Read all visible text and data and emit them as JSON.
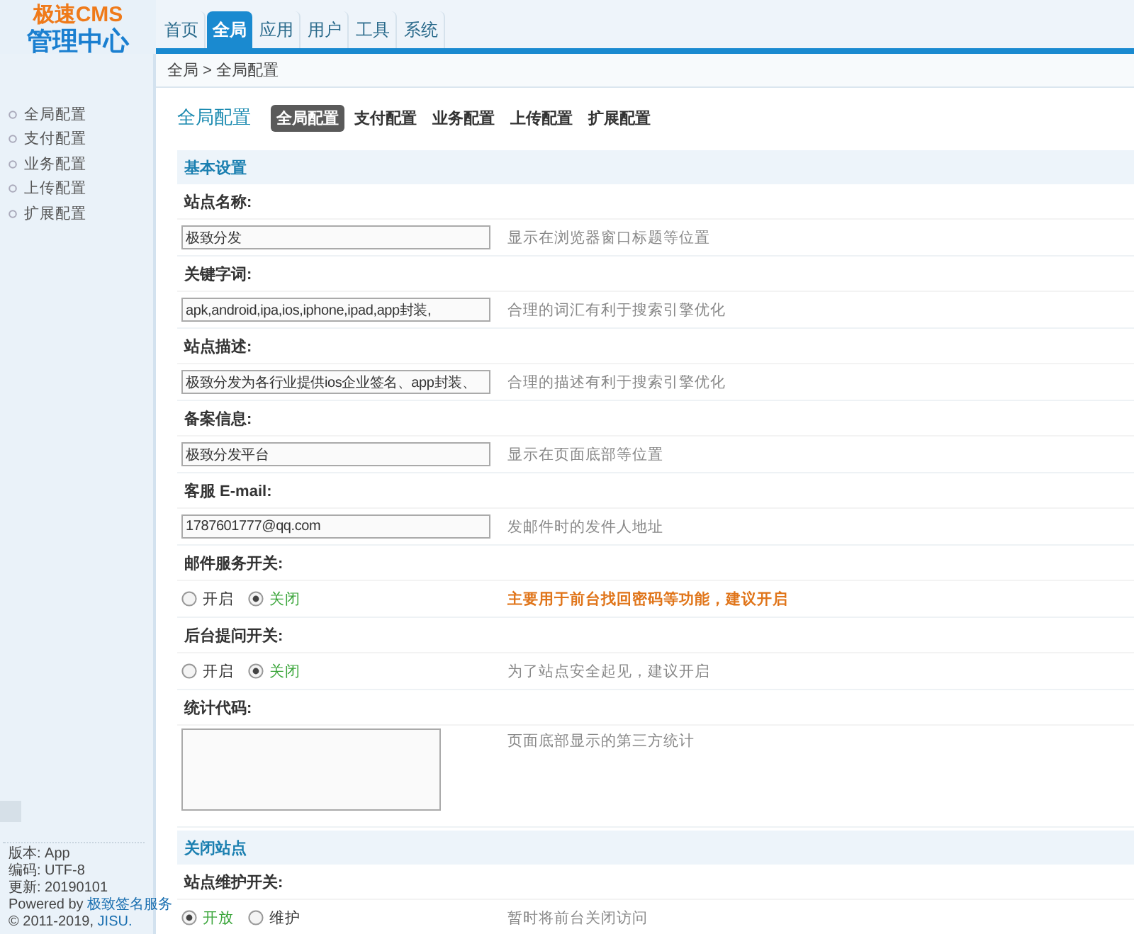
{
  "logo": {
    "line_1": "极速CMS",
    "line_2": "管理中心"
  },
  "nav_tabs": [
    {
      "label": "首页",
      "selected": false
    },
    {
      "label": "全局",
      "selected": true
    },
    {
      "label": "应用",
      "selected": false
    },
    {
      "label": "用户",
      "selected": false
    },
    {
      "label": "工具",
      "selected": false
    },
    {
      "label": "系统",
      "selected": false
    }
  ],
  "breadcrumb": "全局 > 全局配置",
  "sidebar": {
    "items": [
      "全局配置",
      "支付配置",
      "业务配置",
      "上传配置",
      "扩展配置"
    ],
    "info": [
      {
        "text": "版本: App"
      },
      {
        "text": "编码: UTF-8"
      },
      {
        "text": "更新: 20190101"
      },
      {
        "text": "Powered by",
        "link": "极致签名服务"
      },
      {
        "text": "© 2011-2019,",
        "link": "JISU."
      }
    ]
  },
  "page_title": "全局配置",
  "sub_tabs": [
    {
      "label": "全局配置",
      "selected": true
    },
    {
      "label": "支付配置",
      "selected": false
    },
    {
      "label": "业务配置",
      "selected": false
    },
    {
      "label": "上传配置",
      "selected": false
    },
    {
      "label": "扩展配置",
      "selected": false
    }
  ],
  "sections": [
    {
      "title": "基本设置",
      "fields": [
        {
          "kind": "text",
          "label": "站点名称:",
          "value": "极致分发",
          "hint": "显示在浏览器窗口标题等位置",
          "highlight": false
        },
        {
          "kind": "text",
          "label": "关键字词:",
          "value": "apk,android,ipa,ios,iphone,ipad,app封装,",
          "hint": "合理的词汇有利于搜索引擎优化",
          "highlight": false
        },
        {
          "kind": "text",
          "label": "站点描述:",
          "value": "极致分发为各行业提供ios企业签名、app封装、",
          "hint": "合理的描述有利于搜索引擎优化",
          "highlight": false
        },
        {
          "kind": "text",
          "label": "备案信息:",
          "value": "极致分发平台",
          "hint": "显示在页面底部等位置",
          "highlight": false
        },
        {
          "kind": "text",
          "label": "客服 E-mail:",
          "value": "1787601777@qq.com",
          "hint": "发邮件时的发件人地址",
          "highlight": false
        },
        {
          "kind": "radio",
          "label": "邮件服务开关:",
          "options": [
            {
              "label": "开启",
              "selected": false
            },
            {
              "label": "关闭",
              "selected": true
            }
          ],
          "hint": "主要用于前台找回密码等功能，建议开启",
          "highlight": true
        },
        {
          "kind": "radio",
          "label": "后台提问开关:",
          "options": [
            {
              "label": "开启",
              "selected": false
            },
            {
              "label": "关闭",
              "selected": true
            }
          ],
          "hint": "为了站点安全起见，建议开启",
          "highlight": false
        },
        {
          "kind": "textarea",
          "label": "统计代码:",
          "hint": "页面底部显示的第三方统计",
          "highlight": false
        }
      ]
    },
    {
      "title": "关闭站点",
      "fields": [
        {
          "kind": "radio",
          "label": "站点维护开关:",
          "options": [
            {
              "label": "开放",
              "selected": true
            },
            {
              "label": "维护",
              "selected": false
            }
          ],
          "hint": "暂时将前台关闭访问",
          "highlight": false
        }
      ]
    }
  ]
}
